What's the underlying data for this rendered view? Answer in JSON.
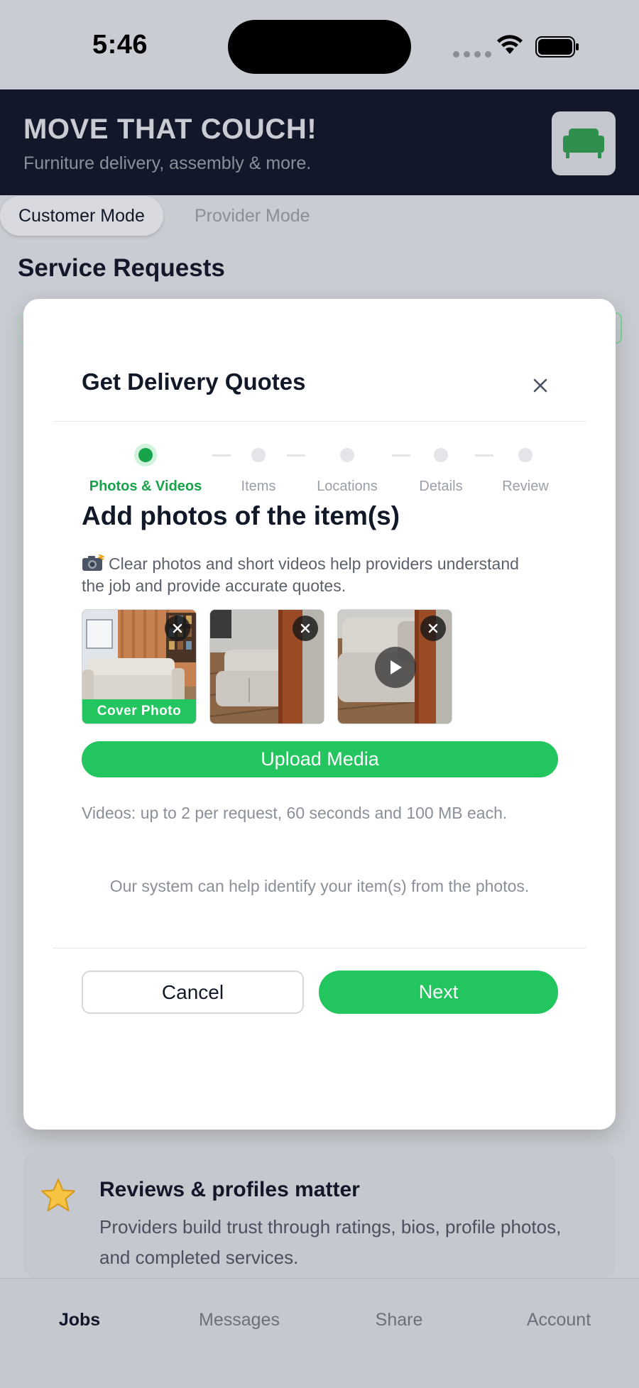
{
  "status_bar": {
    "time": "5:46"
  },
  "header": {
    "title": "MOVE THAT COUCH!",
    "tagline": "Furniture delivery, assembly & more."
  },
  "mode_tabs": {
    "customer": "Customer Mode",
    "provider": "Provider Mode"
  },
  "section_title": "Service Requests",
  "modal": {
    "title": "Get Delivery Quotes",
    "steps": [
      "Photos & Videos",
      "Items",
      "Locations",
      "Details",
      "Review"
    ],
    "current_step": 1,
    "heading": "Add photos of the item(s)",
    "description": "Clear photos and short videos help providers understand the job and provide accurate quotes.",
    "media": [
      {
        "type": "photo",
        "cover": true
      },
      {
        "type": "photo",
        "cover": false
      },
      {
        "type": "video",
        "cover": false
      }
    ],
    "cover_label": "Cover Photo",
    "upload_label": "Upload Media",
    "video_note": "Videos: up to 2 per request, 60 seconds and 100 MB each.",
    "ai_note": "Our system can help identify your item(s) from the photos.",
    "cancel_label": "Cancel",
    "next_label": "Next"
  },
  "info_card": {
    "title": "Reviews & profiles matter",
    "body": "Providers build trust through ratings, bios, profile photos, and completed services."
  },
  "bottom_nav": [
    "Jobs",
    "Messages",
    "Share",
    "Account"
  ],
  "colors": {
    "accent": "#22c55e",
    "header_bg": "#121829"
  }
}
